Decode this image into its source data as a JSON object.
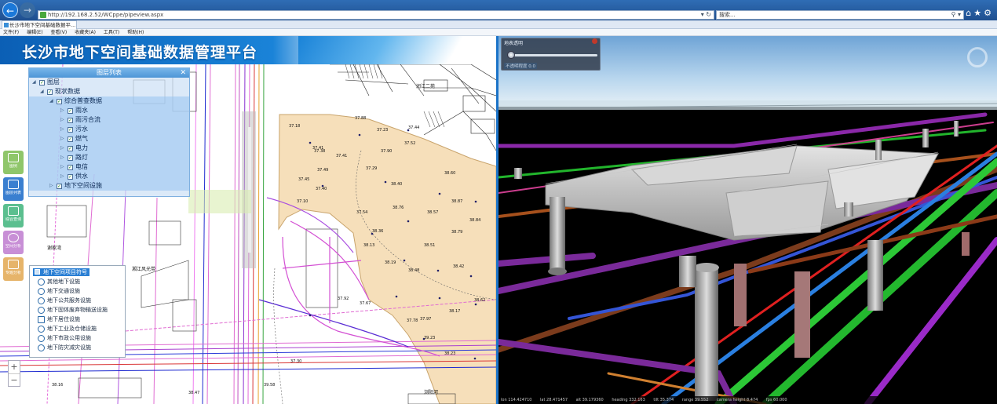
{
  "browser": {
    "url": "http://192.168.2.52/WCppe/pipeview.aspx",
    "search_placeholder": "搜索...",
    "tab_title": "长沙市地下空间基础数据平...",
    "menu": [
      "文件(F)",
      "编辑(E)",
      "查看(V)",
      "收藏夹(A)",
      "工具(T)",
      "帮助(H)"
    ]
  },
  "app": {
    "title": "长沙市地下空间基础数据管理平台"
  },
  "tools": [
    {
      "label": "图例",
      "color": "#8fc66a"
    },
    {
      "label": "图层列表",
      "color": "#3a7fd0"
    },
    {
      "label": "综合查询",
      "color": "#5bbf8f"
    },
    {
      "label": "空间分析",
      "color": "#c88fd6"
    },
    {
      "label": "专题分析",
      "color": "#e6b46a"
    }
  ],
  "layer_panel": {
    "title": "图层列表",
    "items": [
      {
        "label": "图层",
        "level": 0,
        "arrow": "◢"
      },
      {
        "label": "现状数据",
        "level": 1,
        "arrow": "◢"
      },
      {
        "label": "综合普查数据",
        "level": 2,
        "arrow": "◢"
      },
      {
        "label": "雨水",
        "level": 3,
        "arrow": "▷"
      },
      {
        "label": "雨污合流",
        "level": 3,
        "arrow": "▷"
      },
      {
        "label": "污水",
        "level": 3,
        "arrow": "▷"
      },
      {
        "label": "燃气",
        "level": 3,
        "arrow": "▷"
      },
      {
        "label": "电力",
        "level": 3,
        "arrow": "▷"
      },
      {
        "label": "路灯",
        "level": 3,
        "arrow": "▷"
      },
      {
        "label": "电信",
        "level": 3,
        "arrow": "▷"
      },
      {
        "label": "供水",
        "level": 3,
        "arrow": "▷"
      },
      {
        "label": "地下空间设施",
        "level": 2,
        "arrow": "▷"
      }
    ]
  },
  "legend": {
    "title": "地下空间项目符号",
    "items": [
      "其他地下设施",
      "地下交通设施",
      "地下公共服务设施",
      "地下固体废弃物输送设施",
      "地下居住设施",
      "地下工业及仓储设施",
      "地下市政公用设施",
      "地下防灾减灾设施"
    ]
  },
  "map": {
    "elevations": [
      "37.41",
      "37.18",
      "37.49",
      "37.88",
      "37.38",
      "37.41",
      "37.29",
      "37.45",
      "37.23",
      "37.44",
      "37.52",
      "37.90",
      "37.40",
      "37.10",
      "38.40",
      "38.76",
      "38.60",
      "38.87",
      "38.79",
      "38.84",
      "38.57",
      "38.51",
      "38.36",
      "38.13",
      "38.19",
      "38.42",
      "38.48",
      "38.17",
      "38.62",
      "37.92",
      "37.54",
      "37.78",
      "37.97",
      "37.67",
      "39.23",
      "38.23",
      "37.30",
      "38.47",
      "39.58",
      "38.16"
    ],
    "labels": [
      "湘江风光带",
      "润江二苑",
      "谢家湾",
      "浏阳河"
    ]
  },
  "scene": {
    "transparency_title": "地表透明",
    "transparency_value": "不透明程度 0.0",
    "status": [
      "lon 114.424710",
      "lat 28.471457",
      "alt 39.179360",
      "heading 332.163",
      "tilt 35.374",
      "range 39.552",
      "camera height 8.474",
      "fps 60.000"
    ]
  }
}
